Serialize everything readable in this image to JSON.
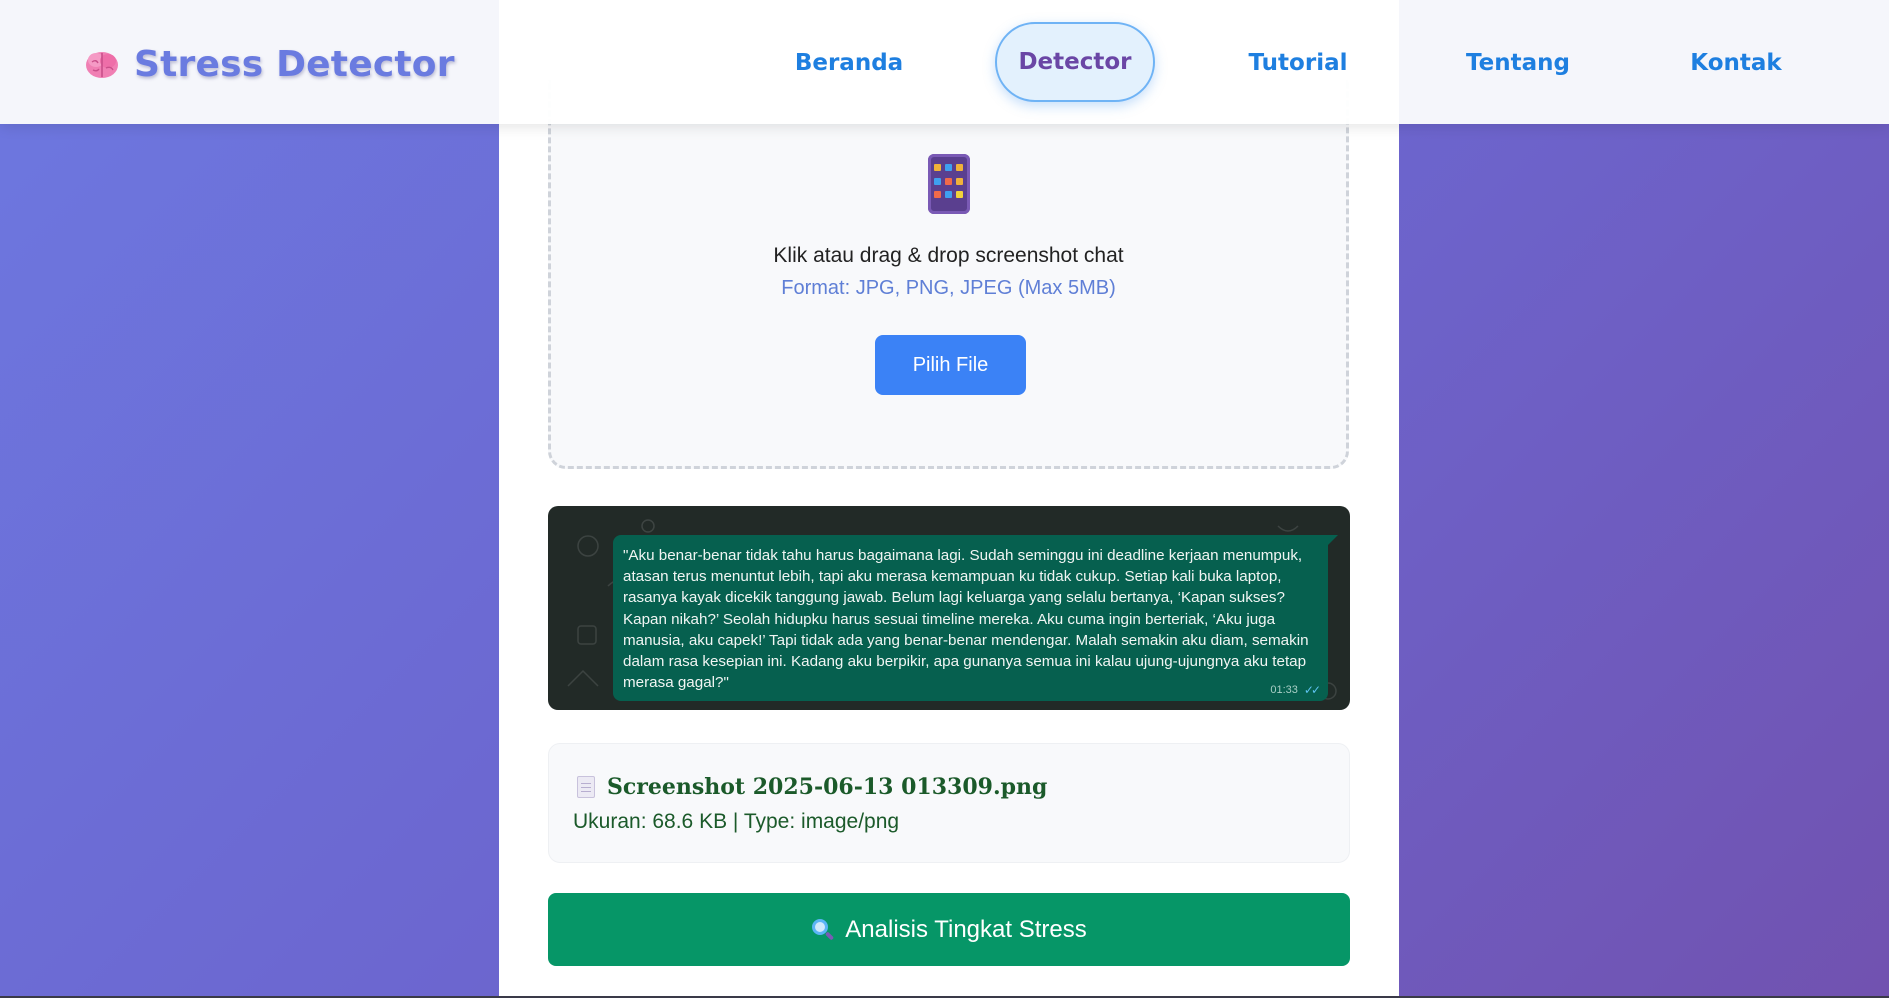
{
  "header": {
    "logo_text": "Stress Detector",
    "nav": [
      {
        "label": "Beranda",
        "active": false
      },
      {
        "label": "Detector",
        "active": true
      },
      {
        "label": "Tutorial",
        "active": false
      },
      {
        "label": "Tentang",
        "active": false
      },
      {
        "label": "Kontak",
        "active": false
      }
    ]
  },
  "upload": {
    "icon": "mobile-phone-icon",
    "title": "Klik atau drag & drop screenshot chat",
    "format": "Format: JPG, PNG, JPEG (Max 5MB)",
    "button_label": "Pilih File"
  },
  "preview": {
    "message": "\"Aku benar-benar tidak tahu harus bagaimana lagi. Sudah seminggu ini deadline kerjaan menumpuk, atasan terus menuntut lebih, tapi aku merasa kemampuan ku tidak cukup. Setiap kali buka laptop, rasanya kayak dicekik tanggung jawab. Belum lagi keluarga yang selalu bertanya, ‘Kapan sukses? Kapan nikah?’ Seolah hidupku harus sesuai timeline mereka. Aku cuma ingin berteriak, ‘Aku juga manusia, aku capek!’ Tapi tidak ada yang benar-benar mendengar. Malah semakin aku diam, semakin dalam rasa kesepian ini. Kadang aku berpikir, apa gunanya semua ini kalau ujung-ujungnya aku tetap merasa gagal?\"",
    "time": "01:33",
    "read_ticks": "✓✓"
  },
  "file": {
    "name": "Screenshot 2025-06-13 013309.png",
    "meta": "Ukuran: 68.6 KB | Type: image/png"
  },
  "analyze": {
    "label": "Analisis Tingkat Stress"
  },
  "colors": {
    "accent_blue": "#3b82f6",
    "analyze_green": "#069667",
    "nav_blue": "#1e7fe0",
    "logo": "#6a7be0"
  }
}
